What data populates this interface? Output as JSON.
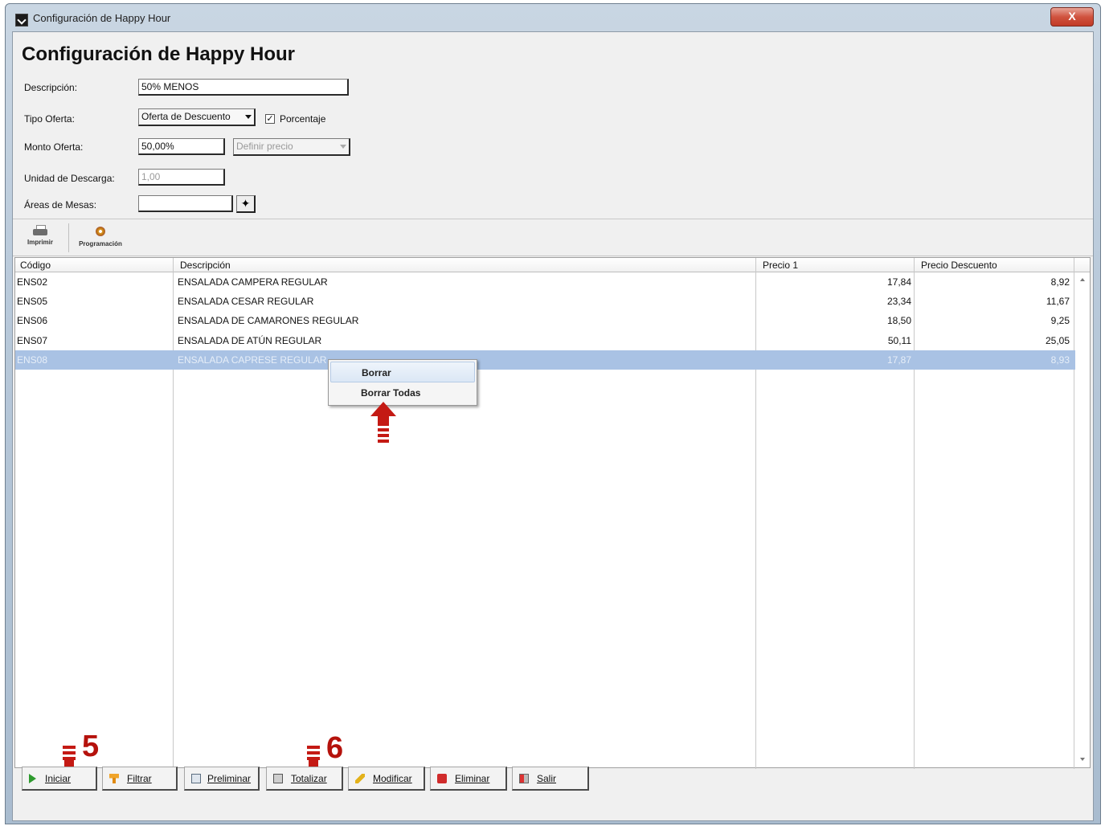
{
  "window": {
    "title": "Configuración de Happy Hour",
    "close_label": "X"
  },
  "form": {
    "heading": "Configuración de Happy Hour",
    "descripcion_label": "Descripción:",
    "descripcion_value": "50% MENOS",
    "tipo_oferta_label": "Tipo Oferta:",
    "tipo_oferta_value": "Oferta de Descuento",
    "porcentaje_label": "Porcentaje",
    "porcentaje_checked": true,
    "monto_oferta_label": "Monto Oferta:",
    "monto_oferta_value": "50,00%",
    "definir_precio_value": "Definir precio",
    "unidad_descarga_label": "Unidad de Descarga:",
    "unidad_descarga_value": "1,00",
    "areas_mesas_label": "Áreas de Mesas:",
    "areas_mesas_value": ""
  },
  "toolbar": {
    "imprimir_label": "Imprimir",
    "programacion_label": "Programación"
  },
  "grid": {
    "columns": [
      "Código",
      "Descripción",
      "Precio 1",
      "Precio Descuento"
    ],
    "rows": [
      {
        "codigo": "ENS02",
        "descripcion": "ENSALADA CAMPERA REGULAR",
        "precio": "17,84",
        "descuento": "8,92"
      },
      {
        "codigo": "ENS05",
        "descripcion": "ENSALADA CESAR REGULAR",
        "precio": "23,34",
        "descuento": "11,67"
      },
      {
        "codigo": "ENS06",
        "descripcion": "ENSALADA DE CAMARONES REGULAR",
        "precio": "18,50",
        "descuento": "9,25"
      },
      {
        "codigo": "ENS07",
        "descripcion": "ENSALADA DE ATÚN REGULAR",
        "precio": "50,11",
        "descuento": "25,05"
      },
      {
        "codigo": "ENS08",
        "descripcion": "ENSALADA CAPRESE REGULAR",
        "precio": "17,87",
        "descuento": "8,93"
      }
    ],
    "selected_row": 4
  },
  "context_menu": {
    "items": [
      "Borrar",
      "Borrar Todas"
    ]
  },
  "annotations": {
    "step_5": "5",
    "step_6": "6",
    "color": "#c41a14"
  },
  "buttons": {
    "iniciar": "Iniciar",
    "filtrar": "Filtrar",
    "preliminar": "Preliminar",
    "totalizar": "Totalizar",
    "modificar": "Modificar",
    "eliminar": "Eliminar",
    "salir": "Salir"
  }
}
